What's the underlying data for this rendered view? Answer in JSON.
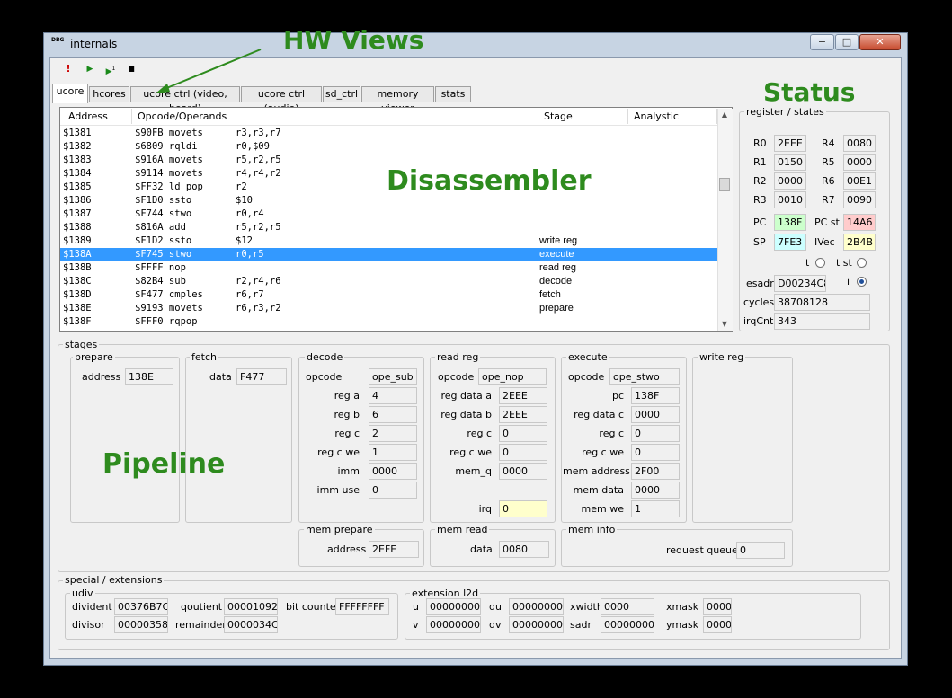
{
  "window": {
    "title": "internals",
    "icon_text": "DBG"
  },
  "overlays": {
    "hw_views": "HW Views",
    "status": "Status",
    "disassembler": "Disassembler",
    "pipeline": "Pipeline"
  },
  "toolbar": {
    "stop_glyph": "!",
    "run_glyph": "▶",
    "step_glyph": "▶",
    "step_sup": "1",
    "pause_glyph": "■"
  },
  "tabs": [
    "ucore",
    "hcores",
    "ucore ctrl (video, board)",
    "ucore ctrl (audio)",
    "sd_ctrl",
    "memory viewer",
    "stats"
  ],
  "disasm": {
    "columns": [
      "Address",
      "Opcode/Operands",
      "Stage",
      "Analystic"
    ],
    "rows": [
      {
        "addr": "$1381",
        "code": "$90FB movets",
        "ops": "r3,r3,r7",
        "stage": ""
      },
      {
        "addr": "$1382",
        "code": "$6809 rqldi",
        "ops": "r0,$09",
        "stage": ""
      },
      {
        "addr": "$1383",
        "code": "$916A movets",
        "ops": "r5,r2,r5",
        "stage": ""
      },
      {
        "addr": "$1384",
        "code": "$9114 movets",
        "ops": "r4,r4,r2",
        "stage": ""
      },
      {
        "addr": "$1385",
        "code": "$FF32 ld pop",
        "ops": "r2",
        "stage": ""
      },
      {
        "addr": "$1386",
        "code": "$F1D0 ssto",
        "ops": "$10",
        "stage": ""
      },
      {
        "addr": "$1387",
        "code": "$F744 stwo",
        "ops": "r0,r4",
        "stage": ""
      },
      {
        "addr": "$1388",
        "code": "$816A add",
        "ops": "r5,r2,r5",
        "stage": ""
      },
      {
        "addr": "$1389",
        "code": "$F1D2 ssto",
        "ops": "$12",
        "stage": "write reg"
      },
      {
        "addr": "$138A",
        "code": "$F745 stwo",
        "ops": "r0,r5",
        "stage": "execute",
        "selected": true
      },
      {
        "addr": "$138B",
        "code": "$FFFF nop",
        "ops": "",
        "stage": "read reg"
      },
      {
        "addr": "$138C",
        "code": "$82B4 sub",
        "ops": "r2,r4,r6",
        "stage": "decode"
      },
      {
        "addr": "$138D",
        "code": "$F477 cmples",
        "ops": "r6,r7",
        "stage": "fetch"
      },
      {
        "addr": "$138E",
        "code": "$9193 movets",
        "ops": "r6,r3,r2",
        "stage": "prepare"
      },
      {
        "addr": "$138F",
        "code": "$FFF0 rqpop",
        "ops": "",
        "stage": ""
      }
    ]
  },
  "registers": {
    "group_title": "register / states",
    "r0": {
      "label": "R0",
      "value": "2EEE"
    },
    "r4": {
      "label": "R4",
      "value": "0080"
    },
    "r1": {
      "label": "R1",
      "value": "0150"
    },
    "r5": {
      "label": "R5",
      "value": "0000"
    },
    "r2": {
      "label": "R2",
      "value": "0000"
    },
    "r6": {
      "label": "R6",
      "value": "00E1"
    },
    "r3": {
      "label": "R3",
      "value": "0010"
    },
    "r7": {
      "label": "R7",
      "value": "0090"
    },
    "pc": {
      "label": "PC",
      "value": "138F"
    },
    "pc_st": {
      "label": "PC st",
      "value": "14A6"
    },
    "sp": {
      "label": "SP",
      "value": "7FE3"
    },
    "ivec": {
      "label": "IVec",
      "value": "2B4B"
    },
    "t": {
      "label": "t"
    },
    "t_st": {
      "label": "t st"
    },
    "esadr": {
      "label": "esadr",
      "value": "D00234C8"
    },
    "i": {
      "label": "i"
    },
    "cycles": {
      "label": "cycles",
      "value": "38708128"
    },
    "irqcnt": {
      "label": "irqCnt",
      "value": "343"
    },
    "colors": {
      "pc": "#ccffcc",
      "pc_st": "#ffcccc",
      "sp": "#ccffff",
      "ivec": "#ffffcc"
    }
  },
  "stages": {
    "title": "stages",
    "prepare": {
      "title": "prepare",
      "address_label": "address",
      "address": "138E"
    },
    "fetch": {
      "title": "fetch",
      "data_label": "data",
      "data": "F477"
    },
    "decode": {
      "title": "decode",
      "opcode_label": "opcode",
      "opcode": "ope_sub",
      "rega_label": "reg a",
      "rega": "4",
      "regb_label": "reg b",
      "regb": "6",
      "regc_label": "reg c",
      "regc": "2",
      "regcwe_label": "reg c we",
      "regcwe": "1",
      "imm_label": "imm",
      "imm": "0000",
      "immuse_label": "imm use",
      "immuse": "0"
    },
    "readreg": {
      "title": "read reg",
      "opcode_label": "opcode",
      "opcode": "ope_nop",
      "rega_label": "reg data a",
      "rega": "2EEE",
      "regb_label": "reg data b",
      "regb": "2EEE",
      "regc_label": "reg c",
      "regc": "0",
      "regcwe_label": "reg c we",
      "regcwe": "0",
      "memq_label": "mem_q",
      "memq": "0000",
      "irq_label": "irq",
      "irq": "0"
    },
    "execute": {
      "title": "execute",
      "opcode_label": "opcode",
      "opcode": "ope_stwo",
      "pc_label": "pc",
      "pc": "138F",
      "regc_data_label": "reg data c",
      "regc_data": "0000",
      "regc_label": "reg c",
      "regc": "0",
      "regcwe_label": "reg c we",
      "regcwe": "0",
      "memaddr_label": "mem address",
      "memaddr": "2F00",
      "memdata_label": "mem data",
      "memdata": "0000",
      "memwe_label": "mem we",
      "memwe": "1"
    },
    "writereg": {
      "title": "write reg"
    },
    "memprepare": {
      "title": "mem prepare",
      "address_label": "address",
      "address": "2EFE"
    },
    "memread": {
      "title": "mem read",
      "data_label": "data",
      "data": "0080"
    },
    "meminfo": {
      "title": "mem info",
      "rq_label": "request queue",
      "rq": "0"
    }
  },
  "special": {
    "title": "special / extensions",
    "udiv": {
      "title": "udiv",
      "divident_label": "divident",
      "divident": "00376B7C",
      "quotient_label": "qoutient",
      "quotient": "00001092",
      "bitcounter_label": "bit counter",
      "bitcounter": "FFFFFFFF",
      "divisor_label": "divisor",
      "divisor": "00000358",
      "remainder_label": "remainder",
      "remainder": "0000034C"
    },
    "l2d": {
      "title": "extension l2d",
      "u_label": "u",
      "u": "00000000",
      "du_label": "du",
      "du": "00000000",
      "xwidth_label": "xwidth",
      "xwidth": "0000",
      "xmask_label": "xmask",
      "xmask": "0000",
      "v_label": "v",
      "v": "00000000",
      "dv_label": "dv",
      "dv": "00000000",
      "sadr_label": "sadr",
      "sadr": "00000000",
      "ymask_label": "ymask",
      "ymask": "0000"
    }
  }
}
